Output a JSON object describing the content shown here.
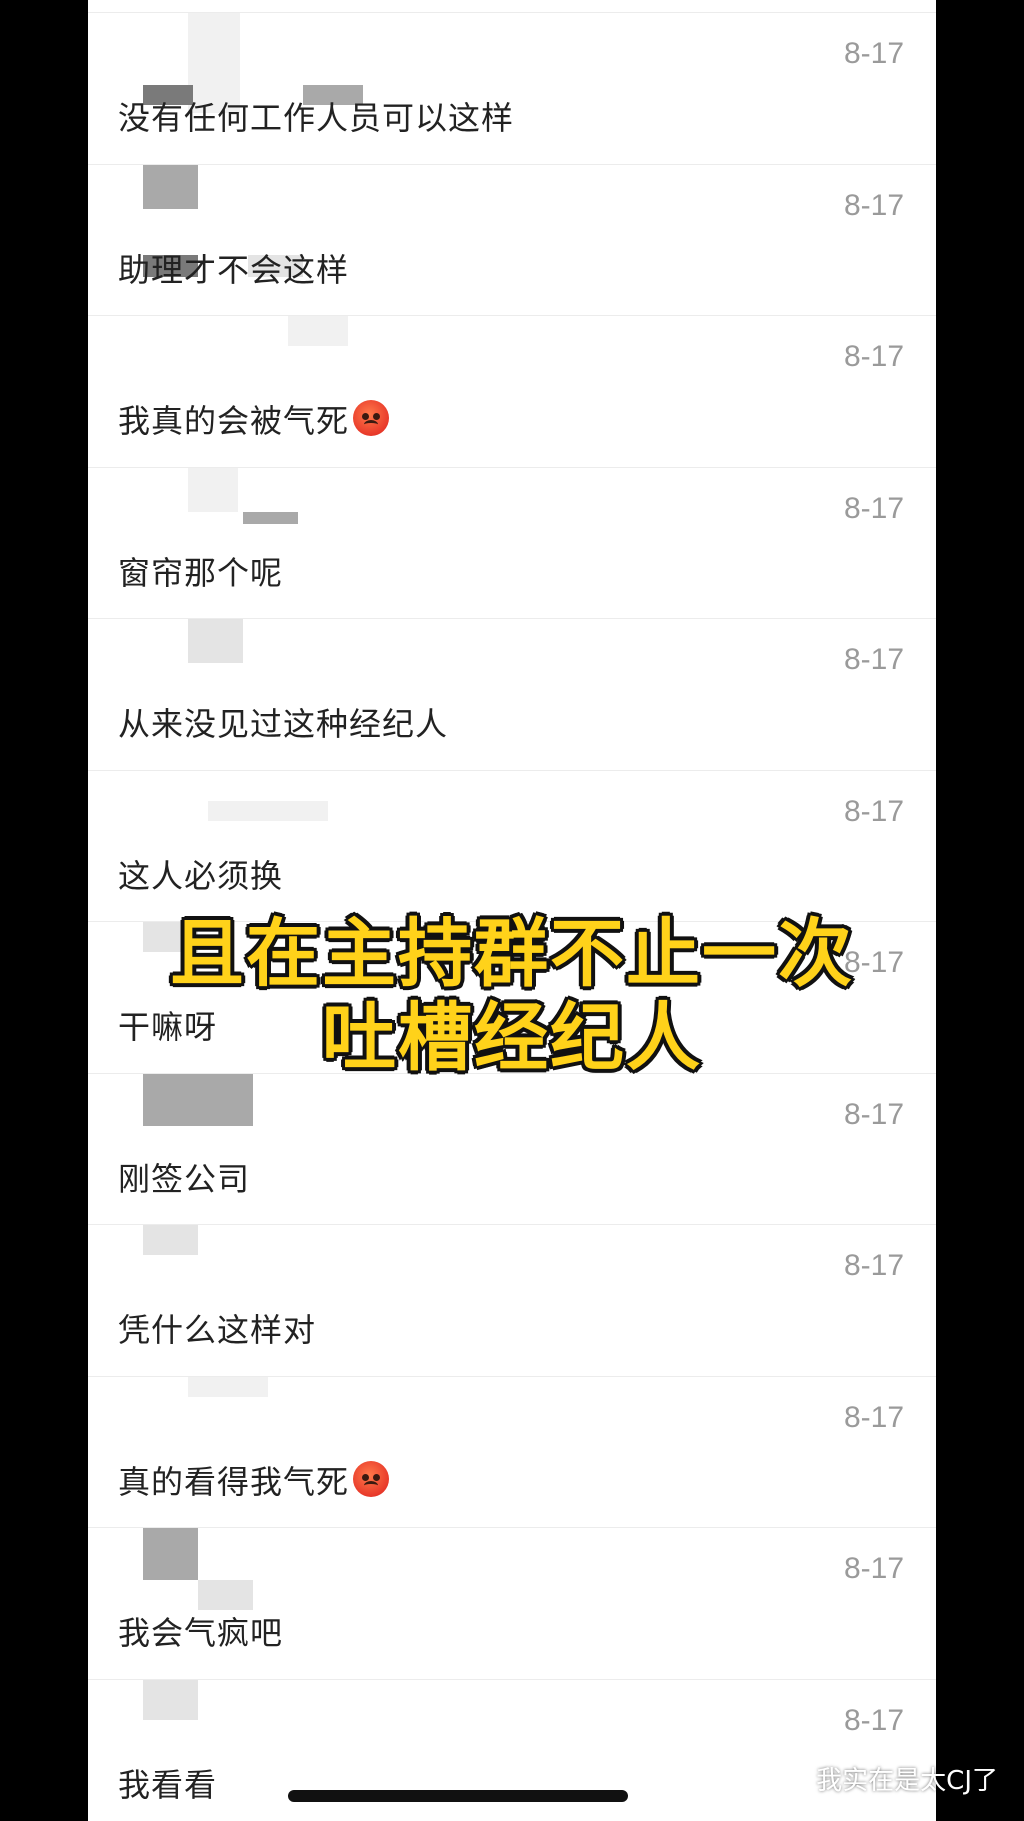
{
  "messages": [
    {
      "text": "没有任何工作人员可以这样",
      "date": "8-17",
      "emoji": false
    },
    {
      "text": "助理才不会这样",
      "date": "8-17",
      "emoji": false
    },
    {
      "text": "我真的会被气死",
      "date": "8-17",
      "emoji": true,
      "emoji_name": "angry-face-icon"
    },
    {
      "text": "窗帘那个呢",
      "date": "8-17",
      "emoji": false
    },
    {
      "text": "从来没见过这种经纪人",
      "date": "8-17",
      "emoji": false
    },
    {
      "text": "这人必须换",
      "date": "8-17",
      "emoji": false
    },
    {
      "text": "干嘛呀",
      "date": "8-17",
      "emoji": false
    },
    {
      "text": "刚签公司",
      "date": "8-17",
      "emoji": false
    },
    {
      "text": "凭什么这样对",
      "date": "8-17",
      "emoji": false
    },
    {
      "text": "真的看得我气死",
      "date": "8-17",
      "emoji": true,
      "emoji_name": "angry-face-icon"
    },
    {
      "text": "我会气疯吧",
      "date": "8-17",
      "emoji": false
    },
    {
      "text": "我看看",
      "date": "8-17",
      "emoji": false
    }
  ],
  "caption": {
    "line1": "且在主持群不止一次",
    "line2": "吐槽经纪人",
    "color": "#ffd21a"
  },
  "watermark": {
    "text": "我实在是太CJ了",
    "icon": "wechat-icon"
  }
}
